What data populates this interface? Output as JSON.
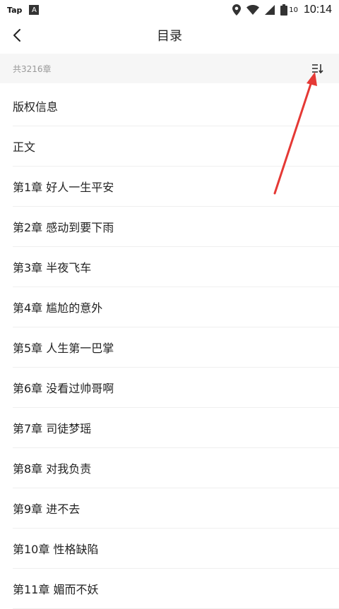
{
  "status_bar": {
    "app_label": "Tap",
    "app_icon_letter": "A",
    "battery": "10",
    "time": "10:14"
  },
  "header": {
    "title": "目录"
  },
  "summary": {
    "count_label": "共3216章"
  },
  "chapters": [
    "版权信息",
    "正文",
    "第1章 好人一生平安",
    "第2章 感动到要下雨",
    "第3章 半夜飞车",
    "第4章 尴尬的意外",
    "第5章 人生第一巴掌",
    "第6章 没看过帅哥啊",
    "第7章 司徒梦瑶",
    "第8章 对我负责",
    "第9章 进不去",
    "第10章 性格缺陷",
    "第11章 媚而不妖"
  ],
  "colors": {
    "annotation_arrow": "#e53935",
    "summary_bg": "#f6f6f6",
    "divider": "#efefef"
  }
}
